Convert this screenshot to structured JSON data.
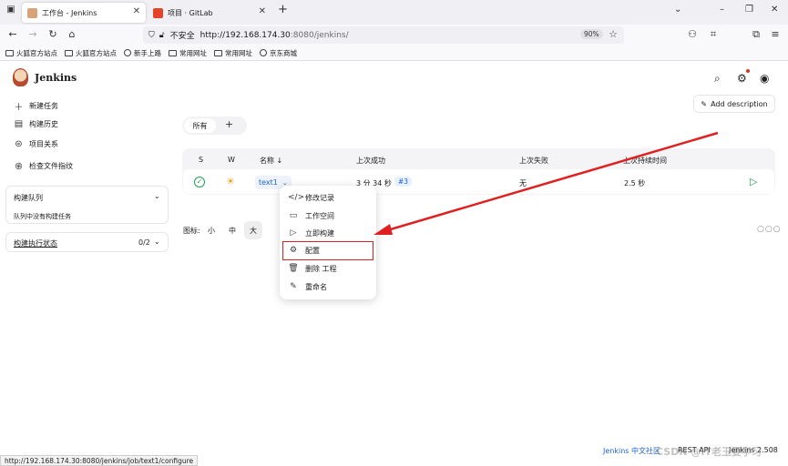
{
  "browser": {
    "tabs": [
      {
        "title": "工作台 - Jenkins",
        "active": true
      },
      {
        "title": "项目 · GitLab",
        "active": false
      }
    ],
    "new_tab_label": "+",
    "security_label": "不安全",
    "url_host": "http://192.168.174.30",
    "url_rest": ":8080/jenkins/",
    "zoom": "90%",
    "bookmarks": [
      "火狐官方站点",
      "火狐官方站点",
      "新手上路",
      "常用网址",
      "常用网址",
      "京东商城"
    ]
  },
  "header": {
    "title": "Jenkins"
  },
  "sidebar": {
    "items": [
      {
        "label": "新建任务",
        "icon": "plus-icon"
      },
      {
        "label": "构建历史",
        "icon": "history-icon"
      },
      {
        "label": "项目关系",
        "icon": "relations-icon"
      },
      {
        "label": "检查文件指纹",
        "icon": "fingerprint-icon"
      }
    ],
    "build_queue": {
      "title": "构建队列",
      "empty_text": "队列中没有构建任务"
    },
    "executors": {
      "title": "构建执行状态",
      "count": "0/2"
    }
  },
  "main": {
    "add_description": "Add description",
    "view_tab_all": "所有",
    "view_tab_add": "+",
    "columns": [
      "S",
      "W",
      "名称 ↓",
      "上次成功",
      "上次失败",
      "上次持续时间"
    ],
    "jobs": [
      {
        "name": "text1",
        "last_success": "3 分 34 秒",
        "build": "#3",
        "last_failure": "无",
        "last_duration": "2.5 秒"
      }
    ],
    "icon_size_label": "图标:",
    "icon_sizes": [
      "小",
      "中",
      "大"
    ]
  },
  "dropdown": {
    "items": [
      {
        "label": "修改记录",
        "icon": "code-icon"
      },
      {
        "label": "工作空间",
        "icon": "folder-icon"
      },
      {
        "label": "立即构建",
        "icon": "play-icon"
      },
      {
        "label": "配置",
        "icon": "gear-icon",
        "highlighted": true
      },
      {
        "label": "删除 工程",
        "icon": "trash-icon"
      },
      {
        "label": "重命名",
        "icon": "pencil-icon"
      }
    ]
  },
  "footer": {
    "community": "Jenkins 中文社区",
    "rest_api": "REST API",
    "version": "Jenkins 2.508"
  },
  "statusbar": {
    "url": "http://192.168.174.30:8080/jenkins/job/text1/configure"
  },
  "watermark": "CSDN @IT老王要学习",
  "colors": {
    "accent_blue": "#1e63d4",
    "success_green": "#1e9e51",
    "annotation_red": "#e02020"
  }
}
